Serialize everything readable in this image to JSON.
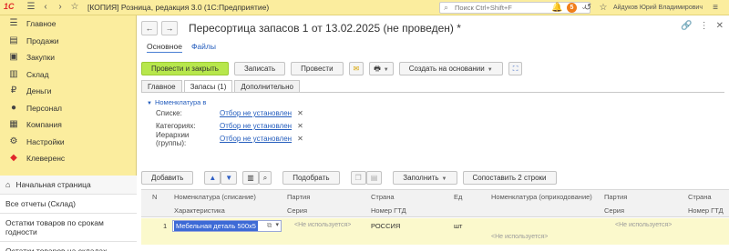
{
  "titlebar": {
    "logo_text": "1С",
    "app_title": "[КОПИЯ] Розница, редакция 3.0  (1С:Предприятие)",
    "search_placeholder": "Поиск Ctrl+Shift+F",
    "notification_count": "5",
    "user_name": "Айдуков Юрий Владимирович"
  },
  "sidebar": {
    "items": [
      {
        "label": "Главное",
        "icon": "menu-icon"
      },
      {
        "label": "Продажи",
        "icon": "sales-icon"
      },
      {
        "label": "Закупки",
        "icon": "purchases-icon"
      },
      {
        "label": "Склад",
        "icon": "warehouse-icon"
      },
      {
        "label": "Деньги",
        "icon": "money-icon"
      },
      {
        "label": "Персонал",
        "icon": "person-icon"
      },
      {
        "label": "Компания",
        "icon": "company-icon"
      },
      {
        "label": "Настройки",
        "icon": "gear-icon"
      },
      {
        "label": "Клеверенс",
        "icon": "cleverence-icon"
      }
    ],
    "links": {
      "start_page": "Начальная страница",
      "all_reports": "Все отчеты (Склад)",
      "stock_by_terms": "Остатки товаров по срокам годности",
      "stock_in_warehouses": "Остатки товаров на складах"
    }
  },
  "document": {
    "title": "Пересортица запасов 1 от 13.02.2025 (не проведен) *",
    "subtabs": {
      "main": "Основное",
      "files": "Файлы"
    },
    "toolbar": {
      "post_and_close": "Провести и закрыть",
      "save": "Записать",
      "post": "Провести",
      "create_based_on": "Создать на основании"
    },
    "tabs": {
      "main": "Главное",
      "stocks": "Запасы (1)",
      "additional": "Дополнительно"
    },
    "filter": {
      "title": "Номенклатура в",
      "rows": [
        {
          "label": "Списке:",
          "value": "Отбор не установлен"
        },
        {
          "label": "Категориях:",
          "value": "Отбор не установлен"
        },
        {
          "label": "Иерархии (группы):",
          "value": "Отбор не установлен"
        }
      ]
    },
    "table_toolbar": {
      "add": "Добавить",
      "pick": "Подобрать",
      "fill": "Заполнить",
      "compare": "Сопоставить 2 строки"
    },
    "table": {
      "headers": {
        "n": "N",
        "nom_write_off": "Номенклатура (списание)",
        "characteristic": "Характеристика",
        "batch": "Партия",
        "series": "Серия",
        "country": "Страна",
        "gtd": "Номер ГТД",
        "unit": "Ед",
        "nom_receipt": "Номенклатура (оприходование)",
        "batch2": "Партия",
        "series2": "Серия",
        "country2": "Страна",
        "gtd2": "Номер ГТД"
      },
      "row": {
        "n": "1",
        "nom": "Мебельная деталь 500х5",
        "not_used": "<Не используется>",
        "country": "РОССИЯ",
        "unit": "шт"
      }
    }
  }
}
